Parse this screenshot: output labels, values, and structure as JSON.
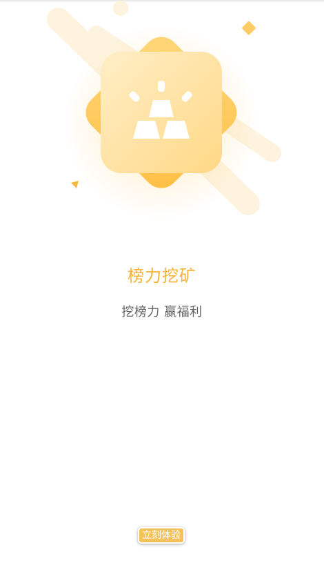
{
  "colors": {
    "accent": "#f3b33d",
    "accent_light": "#ffd980",
    "subtitle": "#666666",
    "background": "#ffffff"
  },
  "feature": {
    "icon": "gold-bars-icon",
    "title": "榜力挖矿",
    "subtitle": "挖榜力 赢福利"
  },
  "actions": {
    "start_label": "立刻体验"
  }
}
